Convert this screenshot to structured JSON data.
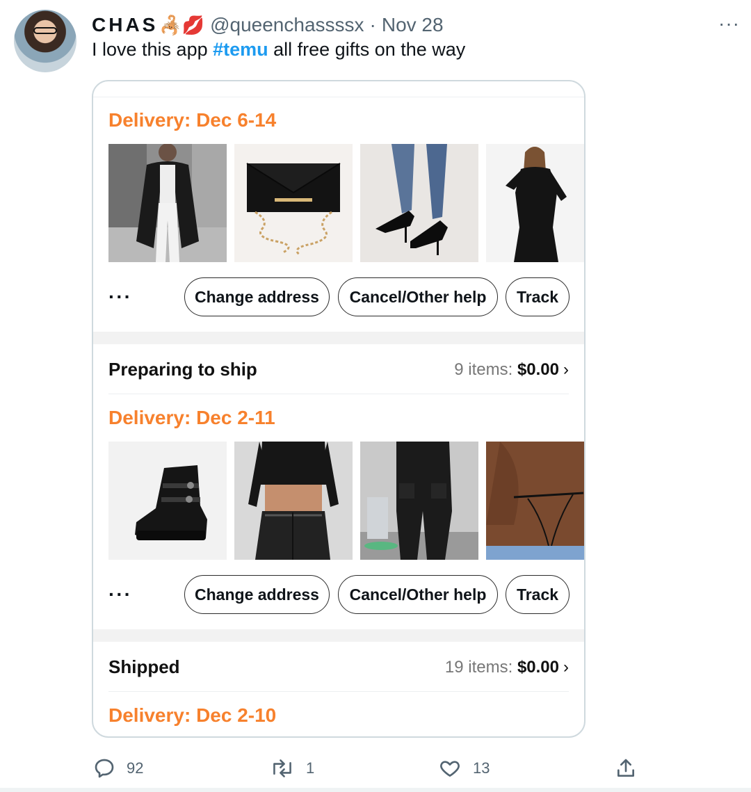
{
  "tweet": {
    "author_name": "CHAS",
    "author_emoji": "🦂💋",
    "handle": "@queenchassssx",
    "separator": "·",
    "date": "Nov 28",
    "more_label": "···",
    "text_before": "I love this app ",
    "hashtag": "#temu",
    "text_after": " all free gifts on the way"
  },
  "orders": {
    "group1": {
      "delivery": "Delivery: Dec 6-14",
      "images": [
        "long black cardigan outfit",
        "black clutch with gold chain",
        "black stiletto heels with jeans",
        "black long-sleeve maxi dress"
      ],
      "actions": {
        "more": "···",
        "change_address": "Change address",
        "cancel_help": "Cancel/Other help",
        "track": "Track"
      }
    },
    "group2": {
      "status": "Preparing to ship",
      "items": "9 items: ",
      "price": "$0.00",
      "chevron": "›",
      "delivery": "Delivery: Dec 2-11",
      "images": [
        "black platform buckle boots",
        "black crop top and leather pants",
        "black cargo pants",
        "thong"
      ],
      "actions": {
        "more": "···",
        "change_address": "Change address",
        "cancel_help": "Cancel/Other help",
        "track": "Track"
      }
    },
    "group3": {
      "status": "Shipped",
      "items": "19 items: ",
      "price": "$0.00",
      "chevron": "›",
      "delivery": "Delivery: Dec 2-10"
    }
  },
  "footer": {
    "reply_count": "92",
    "retweet_count": "1",
    "like_count": "13"
  },
  "colors": {
    "accent_orange": "#f7812d",
    "hashtag_blue": "#1d9bf0",
    "muted": "#536471"
  }
}
